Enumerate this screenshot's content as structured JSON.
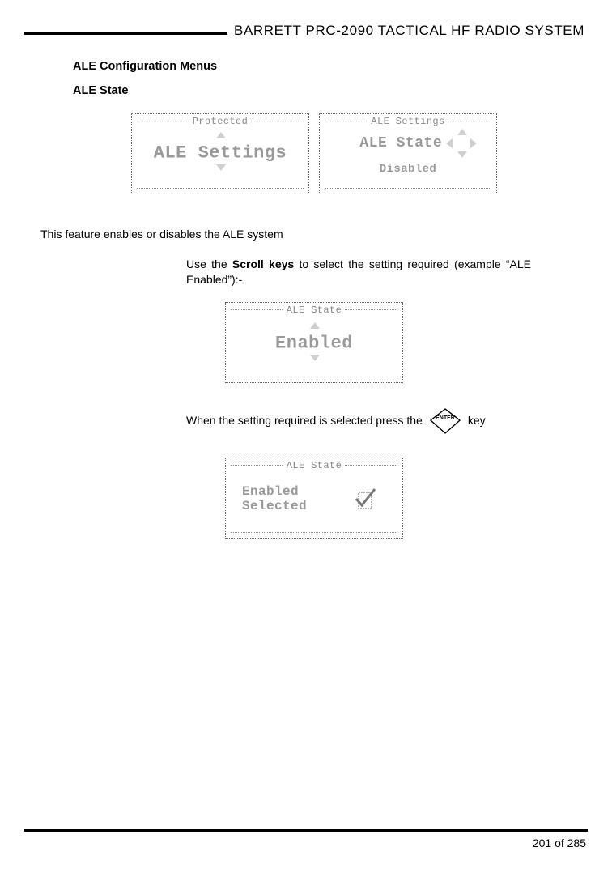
{
  "header": {
    "title": "BARRETT PRC-2090 TACTICAL HF RADIO SYSTEM"
  },
  "section": {
    "title": "ALE Configuration Menus",
    "subtitle": "ALE State"
  },
  "lcd1": {
    "top": "Protected",
    "main": "ALE Settings"
  },
  "lcd2": {
    "top": "ALE Settings",
    "main": "ALE State",
    "sub": "Disabled"
  },
  "text": {
    "intro": "This feature enables or disables the ALE system",
    "step1a": "Use the ",
    "step1b": "Scroll keys",
    "step1c": " to select the setting required (example “ALE Enabled”):-",
    "step2a": "When the setting required is selected press the ",
    "step2b": " key"
  },
  "lcd3": {
    "top": "ALE State",
    "main": "Enabled"
  },
  "enter_key": {
    "label": "ENTER"
  },
  "lcd4": {
    "top": "ALE State",
    "line1": "Enabled",
    "line2": "Selected"
  },
  "footer": {
    "page": "201 of 285"
  }
}
